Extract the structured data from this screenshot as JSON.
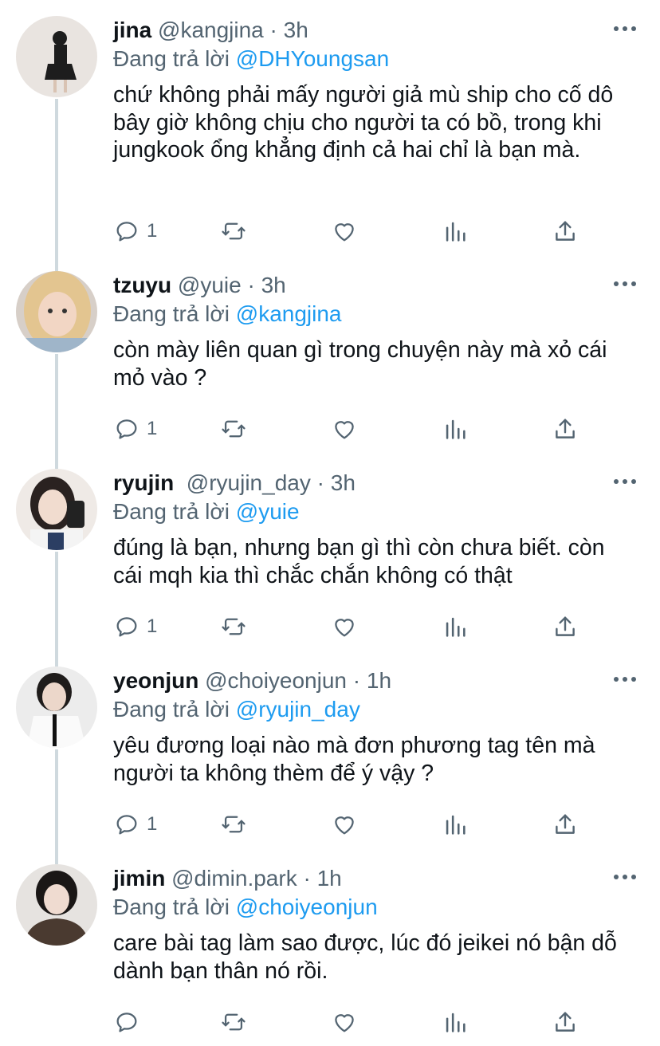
{
  "tweets": [
    {
      "name": "jina",
      "handle": "@kangjina",
      "time": "3h",
      "replying_prefix": "Đang trả lời ",
      "replying_to": "@DHYoungsan",
      "text": "chứ không phải mấy người giả mù ship cho cố dô bây giờ không chịu cho người ta có bồ, trong khi jungkook ổng khẳng định cả hai chỉ là bạn mà.",
      "reply_count": "1"
    },
    {
      "name": "tzuyu",
      "handle": "@yuie",
      "time": "3h",
      "replying_prefix": "Đang trả lời ",
      "replying_to": "@kangjina",
      "text": "còn mày liên quan gì trong chuyện này mà xỏ cái mỏ vào ?",
      "reply_count": "1"
    },
    {
      "name": "ryujin",
      "handle": "@ryujin_day",
      "time": "3h",
      "replying_prefix": "Đang trả lời ",
      "replying_to": "@yuie",
      "text": "đúng là bạn, nhưng bạn gì thì còn chưa biết. còn cái mqh kia thì chắc chắn không có thật",
      "reply_count": "1"
    },
    {
      "name": "yeonjun",
      "handle": "@choiyeonjun",
      "time": "1h",
      "replying_prefix": "Đang trả lời ",
      "replying_to": "@ryujin_day",
      "text": "yêu đương loại nào mà đơn phương tag tên mà người ta không thèm để ý vậy ?",
      "reply_count": "1"
    },
    {
      "name": "jimin",
      "handle": "@dimin.park",
      "time": "1h",
      "replying_prefix": "Đang trả lời ",
      "replying_to": "@choiyeonjun",
      "text": "care bài tag làm sao được, lúc đó jeikei nó bận dỗ dành bạn thân nó rồi.",
      "reply_count": ""
    }
  ],
  "separator": " · ",
  "icons": [
    "reply-icon",
    "retweet-icon",
    "like-icon",
    "analytics-icon",
    "share-icon",
    "more-icon"
  ],
  "colors": {
    "link": "#1d9bf0",
    "secondary": "#536471",
    "thread_line": "#cfd9de",
    "text": "#0f1419"
  }
}
